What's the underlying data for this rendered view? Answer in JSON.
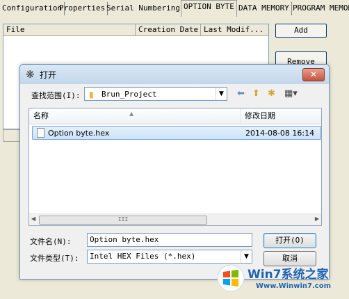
{
  "tabs": [
    "Configuration",
    "Properties",
    "Serial Numbering",
    "OPTION BYTE",
    "DATA MEMORY",
    "PROGRAM MEMORY"
  ],
  "active_tab": "OPTION BYTE",
  "file_list": {
    "columns": [
      "File",
      "Creation Date",
      "Last Modif..."
    ]
  },
  "side_buttons": {
    "add": "Add",
    "remove": "Remove"
  },
  "dialog": {
    "title": "打开",
    "close": "✕",
    "look_in_label": "查找范围(I):",
    "look_in_value": "Brun_Project",
    "columns": {
      "name": "名称",
      "modified": "修改日期"
    },
    "files": [
      {
        "name": "Option byte.hex",
        "modified": "2014-08-08 16:14"
      }
    ],
    "scroll_thumb": "III",
    "file_name_label": "文件名(N):",
    "file_name_value": "Option byte.hex",
    "file_type_label": "文件类型(T):",
    "file_type_value": "Intel HEX Files (*.hex)",
    "open_button": "打开(O)",
    "cancel_button": "取消"
  },
  "watermark": {
    "title": "Win7系统之家",
    "url": "Www.Winwin7.com"
  },
  "colors": {
    "dialog_border": "#6b8eb5",
    "close_button": "#c45439",
    "selection": "#cde3f8",
    "watermark": "#1e62b3"
  }
}
